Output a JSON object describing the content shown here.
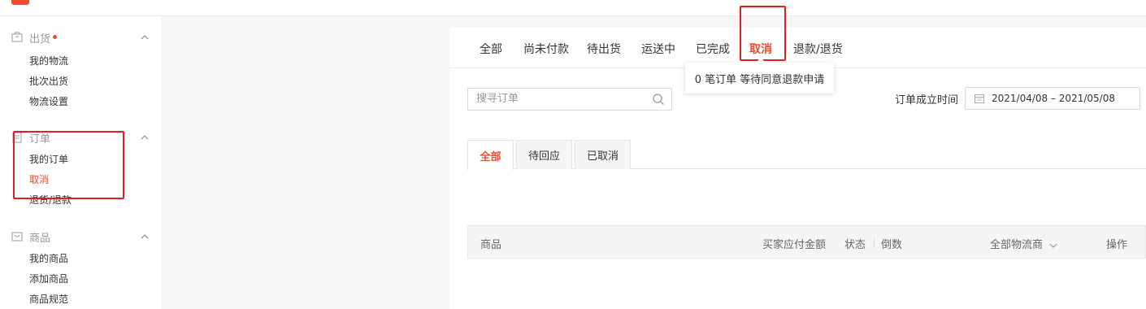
{
  "header": {
    "breadcrumb": ""
  },
  "sidebar": {
    "groups": [
      {
        "title": "出货",
        "has_dot": true,
        "items": [
          "我的物流",
          "批次出货",
          "物流设置"
        ]
      },
      {
        "title": "订单",
        "items": [
          "我的订单",
          "取消",
          "退货/退款"
        ],
        "active_item": "取消"
      },
      {
        "title": "商品",
        "items": [
          "我的商品",
          "添加商品",
          "商品规范"
        ]
      }
    ]
  },
  "status_tabs": [
    "全部",
    "尚未付款",
    "待出货",
    "运送中",
    "已完成",
    "取消",
    "退款/退货"
  ],
  "active_status_tab": "取消",
  "tooltip": "0 笔订单 等待同意退款申请",
  "search": {
    "placeholder": "搜寻订单"
  },
  "date_filter": {
    "label": "订单成立时间",
    "value": "2021/04/08 – 2021/05/08"
  },
  "sub_tabs": [
    "全部",
    "待回应",
    "已取消"
  ],
  "active_sub_tab": "全部",
  "table": {
    "columns": [
      "商品",
      "买家应付金额",
      "状态",
      "倒数",
      "全部物流商",
      "操作"
    ]
  },
  "colors": {
    "accent": "#ee4d2d",
    "highlight_box": "#e02020"
  }
}
